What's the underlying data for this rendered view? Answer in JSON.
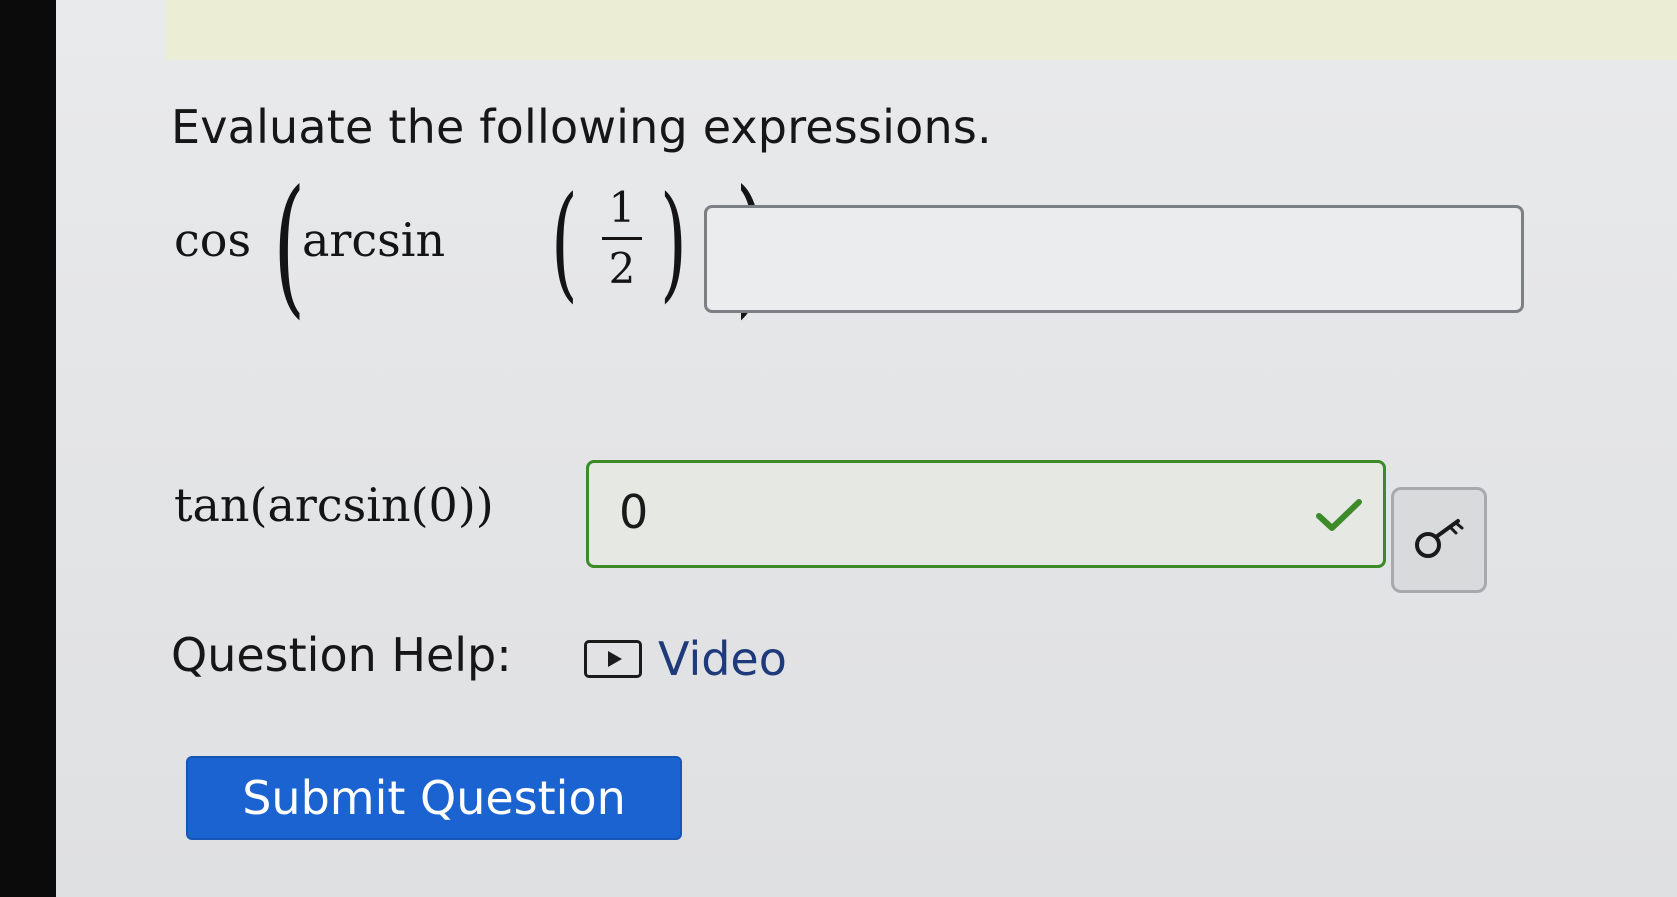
{
  "question": {
    "prompt": "Evaluate the following expressions."
  },
  "expressions": [
    {
      "outer_fn": "cos",
      "inner_fn": "arcsin",
      "numerator": "1",
      "denominator": "2",
      "answer": ""
    },
    {
      "text": "tan(arcsin(0))",
      "answer": "0",
      "status": "correct"
    }
  ],
  "help": {
    "label": "Question Help:",
    "video_label": "Video"
  },
  "actions": {
    "submit_label": "Submit Question"
  },
  "colors": {
    "submit_bg": "#1a63d1",
    "correct_green": "#3c8a28",
    "link_blue": "#1e3a7a"
  },
  "icons": [
    "play-icon",
    "check-icon",
    "key-icon"
  ]
}
